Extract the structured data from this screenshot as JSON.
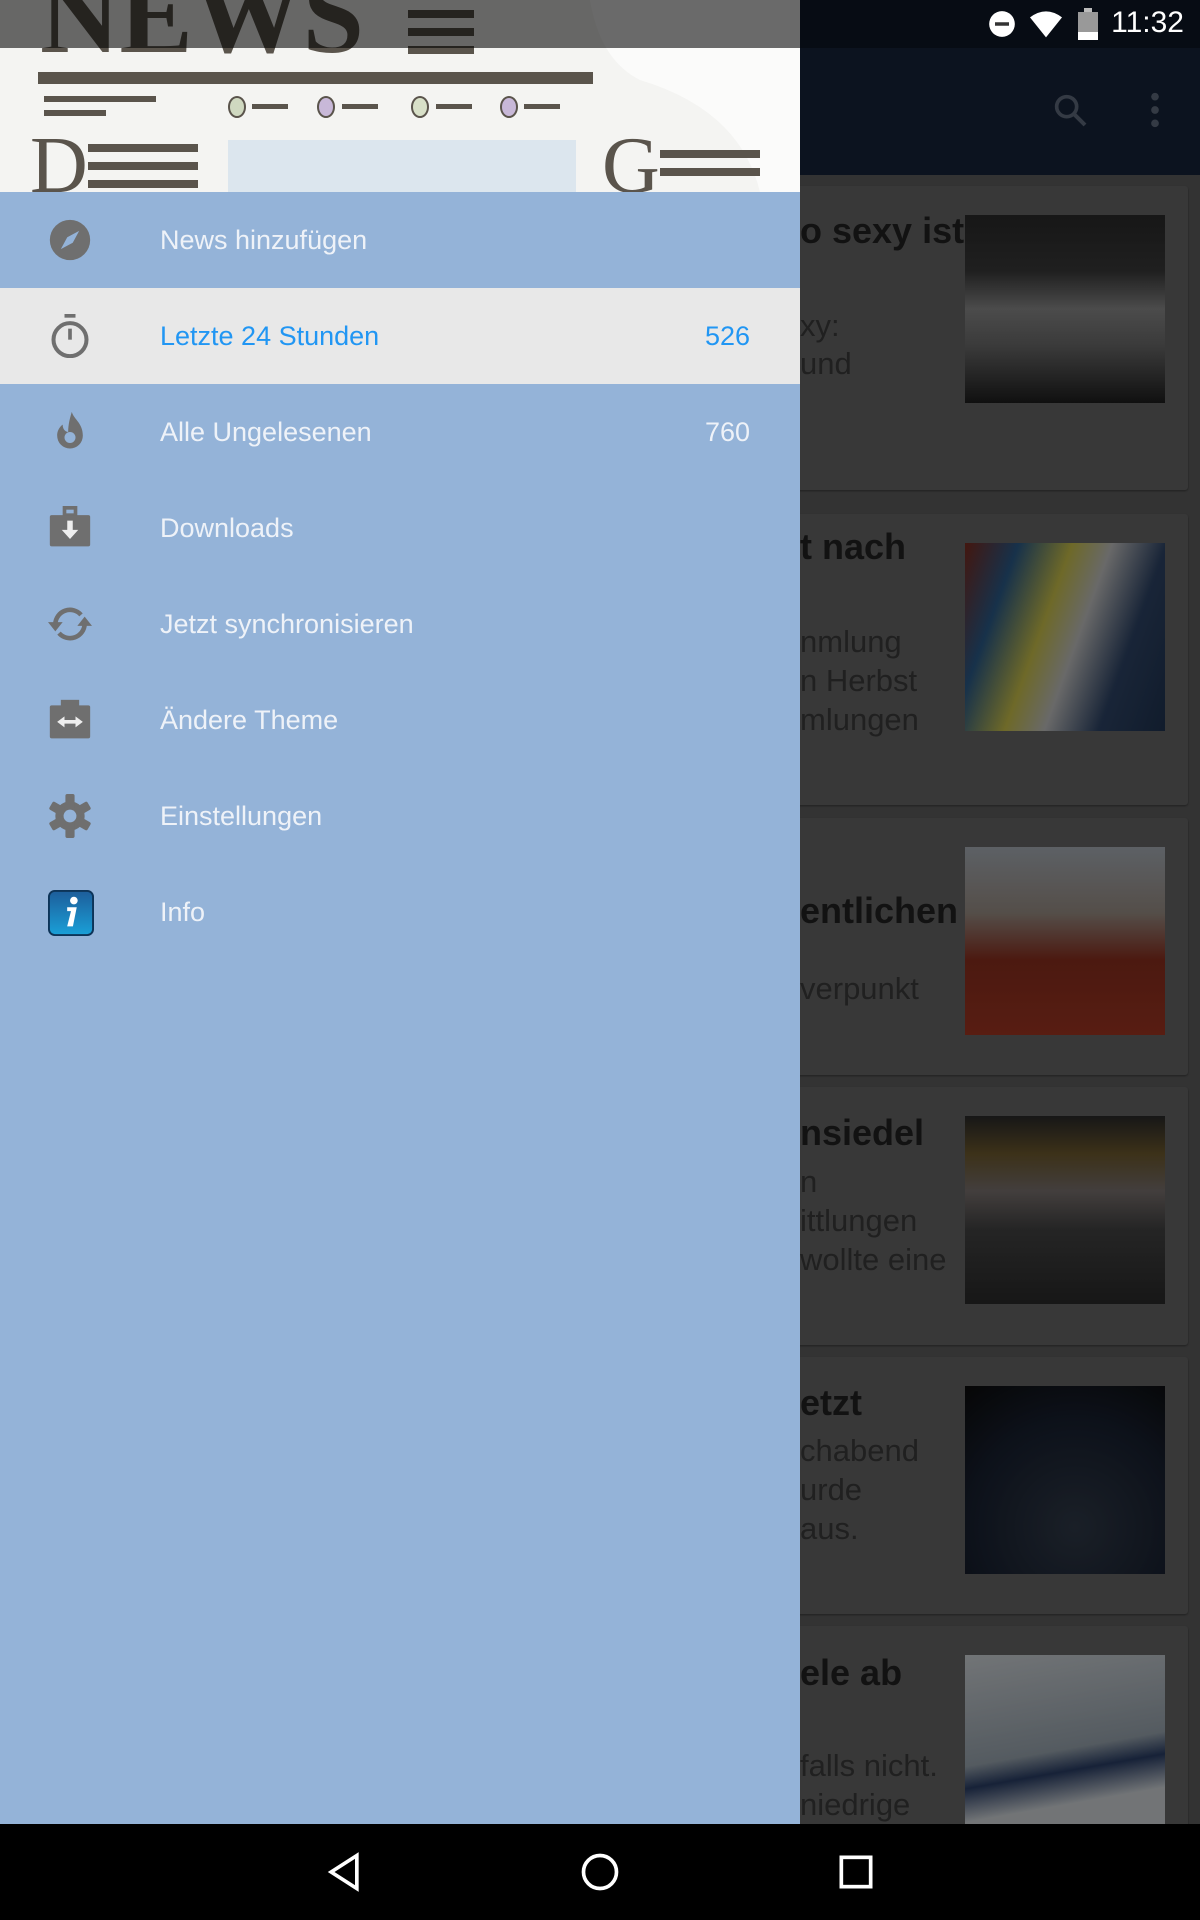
{
  "status_bar": {
    "time": "11:32",
    "icons": [
      "do-not-disturb-icon",
      "wifi-icon",
      "battery-icon"
    ]
  },
  "toolbar": {
    "icons": [
      "search-icon",
      "more-vert-icon"
    ]
  },
  "drawer": {
    "header_image_text": "NEWS",
    "items": [
      {
        "label": "News hinzufügen",
        "icon": "compass-icon",
        "count": ""
      },
      {
        "label": "Letzte 24 Stunden",
        "icon": "timer-icon",
        "count": "526",
        "selected": true
      },
      {
        "label": "Alle Ungelesenen",
        "icon": "flame-icon",
        "count": "760"
      },
      {
        "label": "Downloads",
        "icon": "download-box-icon",
        "count": ""
      },
      {
        "label": "Jetzt synchronisieren",
        "icon": "sync-icon",
        "count": ""
      },
      {
        "label": "Ändere Theme",
        "icon": "theme-swap-icon",
        "count": ""
      },
      {
        "label": "Einstellungen",
        "icon": "gear-icon",
        "count": ""
      },
      {
        "label": "Info",
        "icon": "info-icon",
        "count": ""
      }
    ],
    "accent": "#2196f3"
  },
  "articles": [
    {
      "lines": [
        "o sexy ist",
        "xy:",
        "und"
      ]
    },
    {
      "lines": [
        "t nach",
        "nmlung",
        "n Herbst",
        "mlungen"
      ]
    },
    {
      "lines": [
        "entlichen",
        "verpunkt"
      ]
    },
    {
      "lines": [
        "nsiedel",
        "n",
        "ittlungen",
        "wollte eine"
      ]
    },
    {
      "lines": [
        "etzt",
        "chabend",
        "urde",
        "aus."
      ]
    },
    {
      "lines": [
        "ele ab",
        "falls nicht.",
        "niedrige"
      ]
    }
  ],
  "nav_bar": {
    "icons": [
      "back-icon",
      "home-icon",
      "recents-icon"
    ]
  }
}
